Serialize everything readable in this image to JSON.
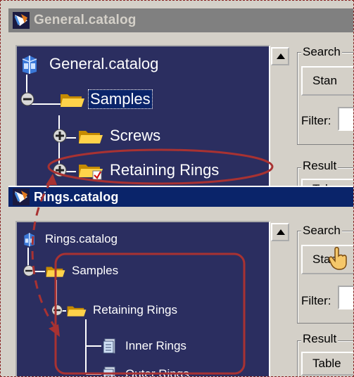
{
  "window_general": {
    "title": "General.catalog",
    "tree": {
      "root": "General.catalog",
      "samples": "Samples",
      "screws": "Screws",
      "retaining_rings": "Retaining Rings"
    },
    "search_group": "Search",
    "standard_button": "Stan",
    "filter_label": "Filter:",
    "result_group": "Result",
    "table_button": "Tab"
  },
  "window_rings": {
    "title": "Rings.catalog",
    "tree": {
      "root": "Rings.catalog",
      "samples": "Samples",
      "retaining_rings": "Retaining Rings",
      "inner_rings": "Inner Rings",
      "outer_rings": "Outer Rings"
    },
    "search_group": "Search",
    "standard_button": "Stan",
    "filter_label": "Filter:",
    "result_group": "Result",
    "table_button": "Table"
  },
  "colors": {
    "tree_bg": "#2b2e60",
    "highlight": "#a83232",
    "active_title": "#0a246a",
    "inactive_title": "#808080"
  },
  "icons": [
    "catalog-app-icon",
    "catalog-book-icon",
    "folder-icon",
    "folder-link-icon",
    "document-icon",
    "expand-plus-icon",
    "collapse-minus-icon",
    "scroll-up-arrow-icon",
    "hand-cursor-icon"
  ]
}
